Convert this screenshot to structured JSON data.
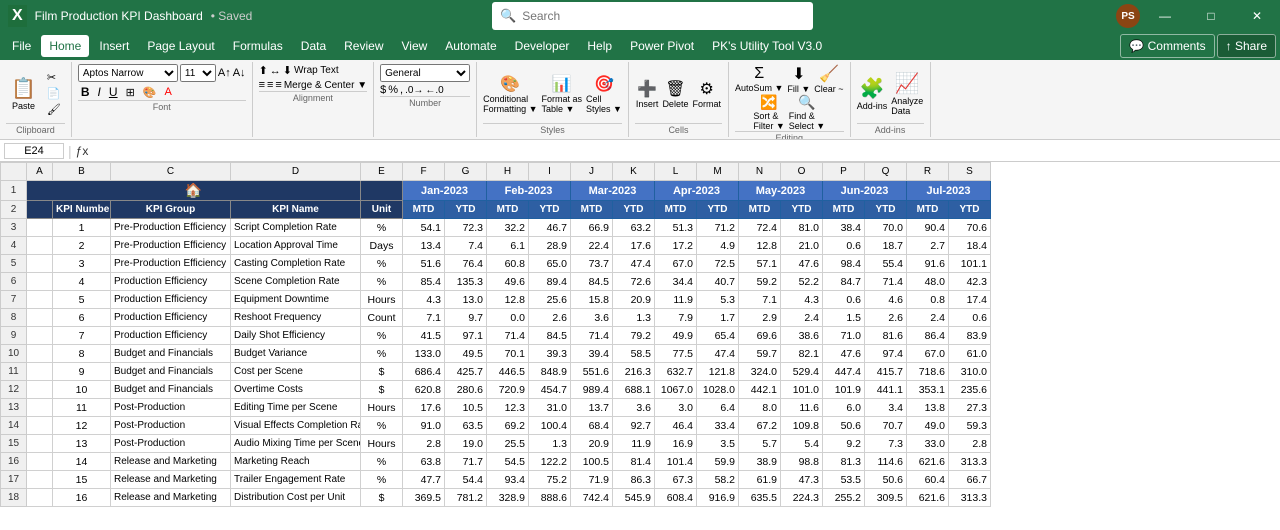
{
  "app": {
    "icon": "X",
    "title": "Film Production KPI Dashboard",
    "saved": "• Saved",
    "user_avatar": "PS"
  },
  "search": {
    "placeholder": "Search"
  },
  "menu": {
    "items": [
      "File",
      "Home",
      "Insert",
      "Page Layout",
      "Formulas",
      "Data",
      "Review",
      "View",
      "Automate",
      "Developer",
      "Help",
      "Power Pivot",
      "PK's Utility Tool V3.0"
    ]
  },
  "ribbon": {
    "clipboard_label": "Clipboard",
    "font_label": "Font",
    "alignment_label": "Alignment",
    "number_label": "Number",
    "styles_label": "Styles",
    "cells_label": "Cells",
    "editing_label": "Editing",
    "addins_label": "Add-ins",
    "font_name": "Aptos Narrow",
    "font_size": "11"
  },
  "formula_bar": {
    "cell": "E24",
    "formula": ""
  },
  "clear_btn": "Clear ~",
  "headers": {
    "row1": [
      "",
      "KPI Number",
      "KPI Group",
      "KPI Name",
      "Unit",
      "Jan-2023",
      "",
      "Feb-2023",
      "",
      "Mar-2023",
      "",
      "Apr-2023",
      "",
      "May-2023",
      "",
      "Jun-2023",
      "",
      "Jul-2023",
      ""
    ],
    "row2": [
      "",
      "",
      "",
      "",
      "",
      "MTD",
      "YTD",
      "MTD",
      "YTD",
      "MTD",
      "YTD",
      "MTD",
      "YTD",
      "MTD",
      "YTD",
      "MTD",
      "YTD",
      "MTD",
      "YTD"
    ]
  },
  "rows": [
    {
      "num": "3",
      "kpi_num": "1",
      "group": "Pre-Production Efficiency",
      "name": "Script Completion Rate",
      "unit": "%",
      "jan_mtd": "54.1",
      "jan_ytd": "72.3",
      "feb_mtd": "32.2",
      "feb_ytd": "46.7",
      "mar_mtd": "66.9",
      "mar_ytd": "63.2",
      "apr_mtd": "51.3",
      "apr_ytd": "71.2",
      "may_mtd": "72.4",
      "may_ytd": "81.0",
      "jun_mtd": "38.4",
      "jun_ytd": "70.0",
      "jul_mtd": "90.4",
      "jul_ytd": "70.6"
    },
    {
      "num": "4",
      "kpi_num": "2",
      "group": "Pre-Production Efficiency",
      "name": "Location Approval Time",
      "unit": "Days",
      "jan_mtd": "13.4",
      "jan_ytd": "7.4",
      "feb_mtd": "6.1",
      "feb_ytd": "28.9",
      "mar_mtd": "22.4",
      "mar_ytd": "17.6",
      "apr_mtd": "17.2",
      "apr_ytd": "4.9",
      "may_mtd": "12.8",
      "may_ytd": "21.0",
      "jun_mtd": "0.6",
      "jun_ytd": "18.7",
      "jul_mtd": "2.7",
      "jul_ytd": "18.4"
    },
    {
      "num": "5",
      "kpi_num": "3",
      "group": "Pre-Production Efficiency",
      "name": "Casting Completion Rate",
      "unit": "%",
      "jan_mtd": "51.6",
      "jan_ytd": "76.4",
      "feb_mtd": "60.8",
      "feb_ytd": "65.0",
      "mar_mtd": "73.7",
      "mar_ytd": "47.4",
      "apr_mtd": "67.0",
      "apr_ytd": "72.5",
      "may_mtd": "57.1",
      "may_ytd": "47.6",
      "jun_mtd": "98.4",
      "jun_ytd": "55.4",
      "jul_mtd": "91.6",
      "jul_ytd": "101.1"
    },
    {
      "num": "6",
      "kpi_num": "4",
      "group": "Production Efficiency",
      "name": "Scene Completion Rate",
      "unit": "%",
      "jan_mtd": "85.4",
      "jan_ytd": "135.3",
      "feb_mtd": "49.6",
      "feb_ytd": "89.4",
      "mar_mtd": "84.5",
      "mar_ytd": "72.6",
      "apr_mtd": "34.4",
      "apr_ytd": "40.7",
      "may_mtd": "59.2",
      "may_ytd": "52.2",
      "jun_mtd": "84.7",
      "jun_ytd": "71.4",
      "jul_mtd": "48.0",
      "jul_ytd": "42.3"
    },
    {
      "num": "7",
      "kpi_num": "5",
      "group": "Production Efficiency",
      "name": "Equipment Downtime",
      "unit": "Hours",
      "jan_mtd": "4.3",
      "jan_ytd": "13.0",
      "feb_mtd": "12.8",
      "feb_ytd": "25.6",
      "mar_mtd": "15.8",
      "mar_ytd": "20.9",
      "apr_mtd": "11.9",
      "apr_ytd": "5.3",
      "may_mtd": "7.1",
      "may_ytd": "4.3",
      "jun_mtd": "0.6",
      "jun_ytd": "4.6",
      "jul_mtd": "0.8",
      "jul_ytd": "17.4"
    },
    {
      "num": "8",
      "kpi_num": "6",
      "group": "Production Efficiency",
      "name": "Reshoot Frequency",
      "unit": "Count",
      "jan_mtd": "7.1",
      "jan_ytd": "9.7",
      "feb_mtd": "0.0",
      "feb_ytd": "2.6",
      "mar_mtd": "3.6",
      "mar_ytd": "1.3",
      "apr_mtd": "7.9",
      "apr_ytd": "1.7",
      "may_mtd": "2.9",
      "may_ytd": "2.4",
      "jun_mtd": "1.5",
      "jun_ytd": "2.6",
      "jul_mtd": "2.4",
      "jul_ytd": "0.6"
    },
    {
      "num": "9",
      "kpi_num": "7",
      "group": "Production Efficiency",
      "name": "Daily Shot Efficiency",
      "unit": "%",
      "jan_mtd": "41.5",
      "jan_ytd": "97.1",
      "feb_mtd": "71.4",
      "feb_ytd": "84.5",
      "mar_mtd": "71.4",
      "mar_ytd": "79.2",
      "apr_mtd": "49.9",
      "apr_ytd": "65.4",
      "may_mtd": "69.6",
      "may_ytd": "38.6",
      "jun_mtd": "71.0",
      "jun_ytd": "81.6",
      "jul_mtd": "86.4",
      "jul_ytd": "83.9"
    },
    {
      "num": "10",
      "kpi_num": "8",
      "group": "Budget and Financials",
      "name": "Budget Variance",
      "unit": "%",
      "jan_mtd": "133.0",
      "jan_ytd": "49.5",
      "feb_mtd": "70.1",
      "feb_ytd": "39.3",
      "mar_mtd": "39.4",
      "mar_ytd": "58.5",
      "apr_mtd": "77.5",
      "apr_ytd": "47.4",
      "may_mtd": "59.7",
      "may_ytd": "82.1",
      "jun_mtd": "47.6",
      "jun_ytd": "97.4",
      "jul_mtd": "67.0",
      "jul_ytd": "61.0"
    },
    {
      "num": "11",
      "kpi_num": "9",
      "group": "Budget and Financials",
      "name": "Cost per Scene",
      "unit": "$",
      "jan_mtd": "686.4",
      "jan_ytd": "425.7",
      "feb_mtd": "446.5",
      "feb_ytd": "848.9",
      "mar_mtd": "551.6",
      "mar_ytd": "216.3",
      "apr_mtd": "632.7",
      "apr_ytd": "121.8",
      "may_mtd": "324.0",
      "may_ytd": "529.4",
      "jun_mtd": "447.4",
      "jun_ytd": "415.7",
      "jul_mtd": "718.6",
      "jul_ytd": "310.0"
    },
    {
      "num": "12",
      "kpi_num": "10",
      "group": "Budget and Financials",
      "name": "Overtime Costs",
      "unit": "$",
      "jan_mtd": "620.8",
      "jan_ytd": "280.6",
      "feb_mtd": "720.9",
      "feb_ytd": "454.7",
      "mar_mtd": "989.4",
      "mar_ytd": "688.1",
      "apr_mtd": "1067.0",
      "apr_ytd": "1028.0",
      "may_mtd": "442.1",
      "may_ytd": "101.0",
      "jun_mtd": "101.9",
      "jun_ytd": "441.1",
      "jul_mtd": "353.1",
      "jul_ytd": "235.6"
    },
    {
      "num": "13",
      "kpi_num": "11",
      "group": "Post-Production",
      "name": "Editing Time per Scene",
      "unit": "Hours",
      "jan_mtd": "17.6",
      "jan_ytd": "10.5",
      "feb_mtd": "12.3",
      "feb_ytd": "31.0",
      "mar_mtd": "13.7",
      "mar_ytd": "3.6",
      "apr_mtd": "3.0",
      "apr_ytd": "6.4",
      "may_mtd": "8.0",
      "may_ytd": "11.6",
      "jun_mtd": "6.0",
      "jun_ytd": "3.4",
      "jul_mtd": "13.8",
      "jul_ytd": "27.3"
    },
    {
      "num": "14",
      "kpi_num": "12",
      "group": "Post-Production",
      "name": "Visual Effects Completion Rate",
      "unit": "%",
      "jan_mtd": "91.0",
      "jan_ytd": "63.5",
      "feb_mtd": "69.2",
      "feb_ytd": "100.4",
      "mar_mtd": "68.4",
      "mar_ytd": "92.7",
      "apr_mtd": "46.4",
      "apr_ytd": "33.4",
      "may_mtd": "67.2",
      "may_ytd": "109.8",
      "jun_mtd": "50.6",
      "jun_ytd": "70.7",
      "jul_mtd": "49.0",
      "jul_ytd": "59.3"
    },
    {
      "num": "15",
      "kpi_num": "13",
      "group": "Post-Production",
      "name": "Audio Mixing Time per Scene",
      "unit": "Hours",
      "jan_mtd": "2.8",
      "jan_ytd": "19.0",
      "feb_mtd": "25.5",
      "feb_ytd": "1.3",
      "mar_mtd": "20.9",
      "mar_ytd": "11.9",
      "apr_mtd": "16.9",
      "apr_ytd": "3.5",
      "may_mtd": "5.7",
      "may_ytd": "5.4",
      "jun_mtd": "9.2",
      "jun_ytd": "7.3",
      "jul_mtd": "33.0",
      "jul_ytd": "2.8"
    },
    {
      "num": "16",
      "kpi_num": "14",
      "group": "Release and Marketing",
      "name": "Marketing Reach",
      "unit": "%",
      "jan_mtd": "63.8",
      "jan_ytd": "71.7",
      "feb_mtd": "54.5",
      "feb_ytd": "122.2",
      "mar_mtd": "100.5",
      "mar_ytd": "81.4",
      "apr_mtd": "101.4",
      "apr_ytd": "59.9",
      "may_mtd": "38.9",
      "may_ytd": "98.8",
      "jun_mtd": "81.3",
      "jun_ytd": "114.6",
      "jul_mtd": "621.6",
      "jul_ytd": "313.3"
    },
    {
      "num": "17",
      "kpi_num": "15",
      "group": "Release and Marketing",
      "name": "Trailer Engagement Rate",
      "unit": "%",
      "jan_mtd": "47.7",
      "jan_ytd": "54.4",
      "feb_mtd": "93.4",
      "feb_ytd": "75.2",
      "mar_mtd": "71.9",
      "mar_ytd": "86.3",
      "apr_mtd": "67.3",
      "apr_ytd": "58.2",
      "may_mtd": "61.9",
      "may_ytd": "47.3",
      "jun_mtd": "53.5",
      "jun_ytd": "50.6",
      "jul_mtd": "60.4",
      "jul_ytd": "66.7"
    },
    {
      "num": "18",
      "kpi_num": "16",
      "group": "Release and Marketing",
      "name": "Distribution Cost per Unit",
      "unit": "$",
      "jan_mtd": "369.5",
      "jan_ytd": "781.2",
      "feb_mtd": "328.9",
      "feb_ytd": "888.6",
      "mar_mtd": "742.4",
      "mar_ytd": "545.9",
      "apr_mtd": "608.4",
      "apr_ytd": "916.9",
      "may_mtd": "635.5",
      "may_ytd": "224.3",
      "jun_mtd": "255.2",
      "jun_ytd": "309.5",
      "jul_mtd": "621.6",
      "jul_ytd": "313.3"
    }
  ],
  "col_headers": [
    "A",
    "B",
    "C",
    "D",
    "E",
    "F",
    "G",
    "H",
    "I",
    "J",
    "K",
    "L",
    "M",
    "N",
    "O",
    "P",
    "Q",
    "R",
    "S"
  ],
  "window_controls": {
    "minimize": "—",
    "maximize": "□",
    "close": "✕"
  }
}
